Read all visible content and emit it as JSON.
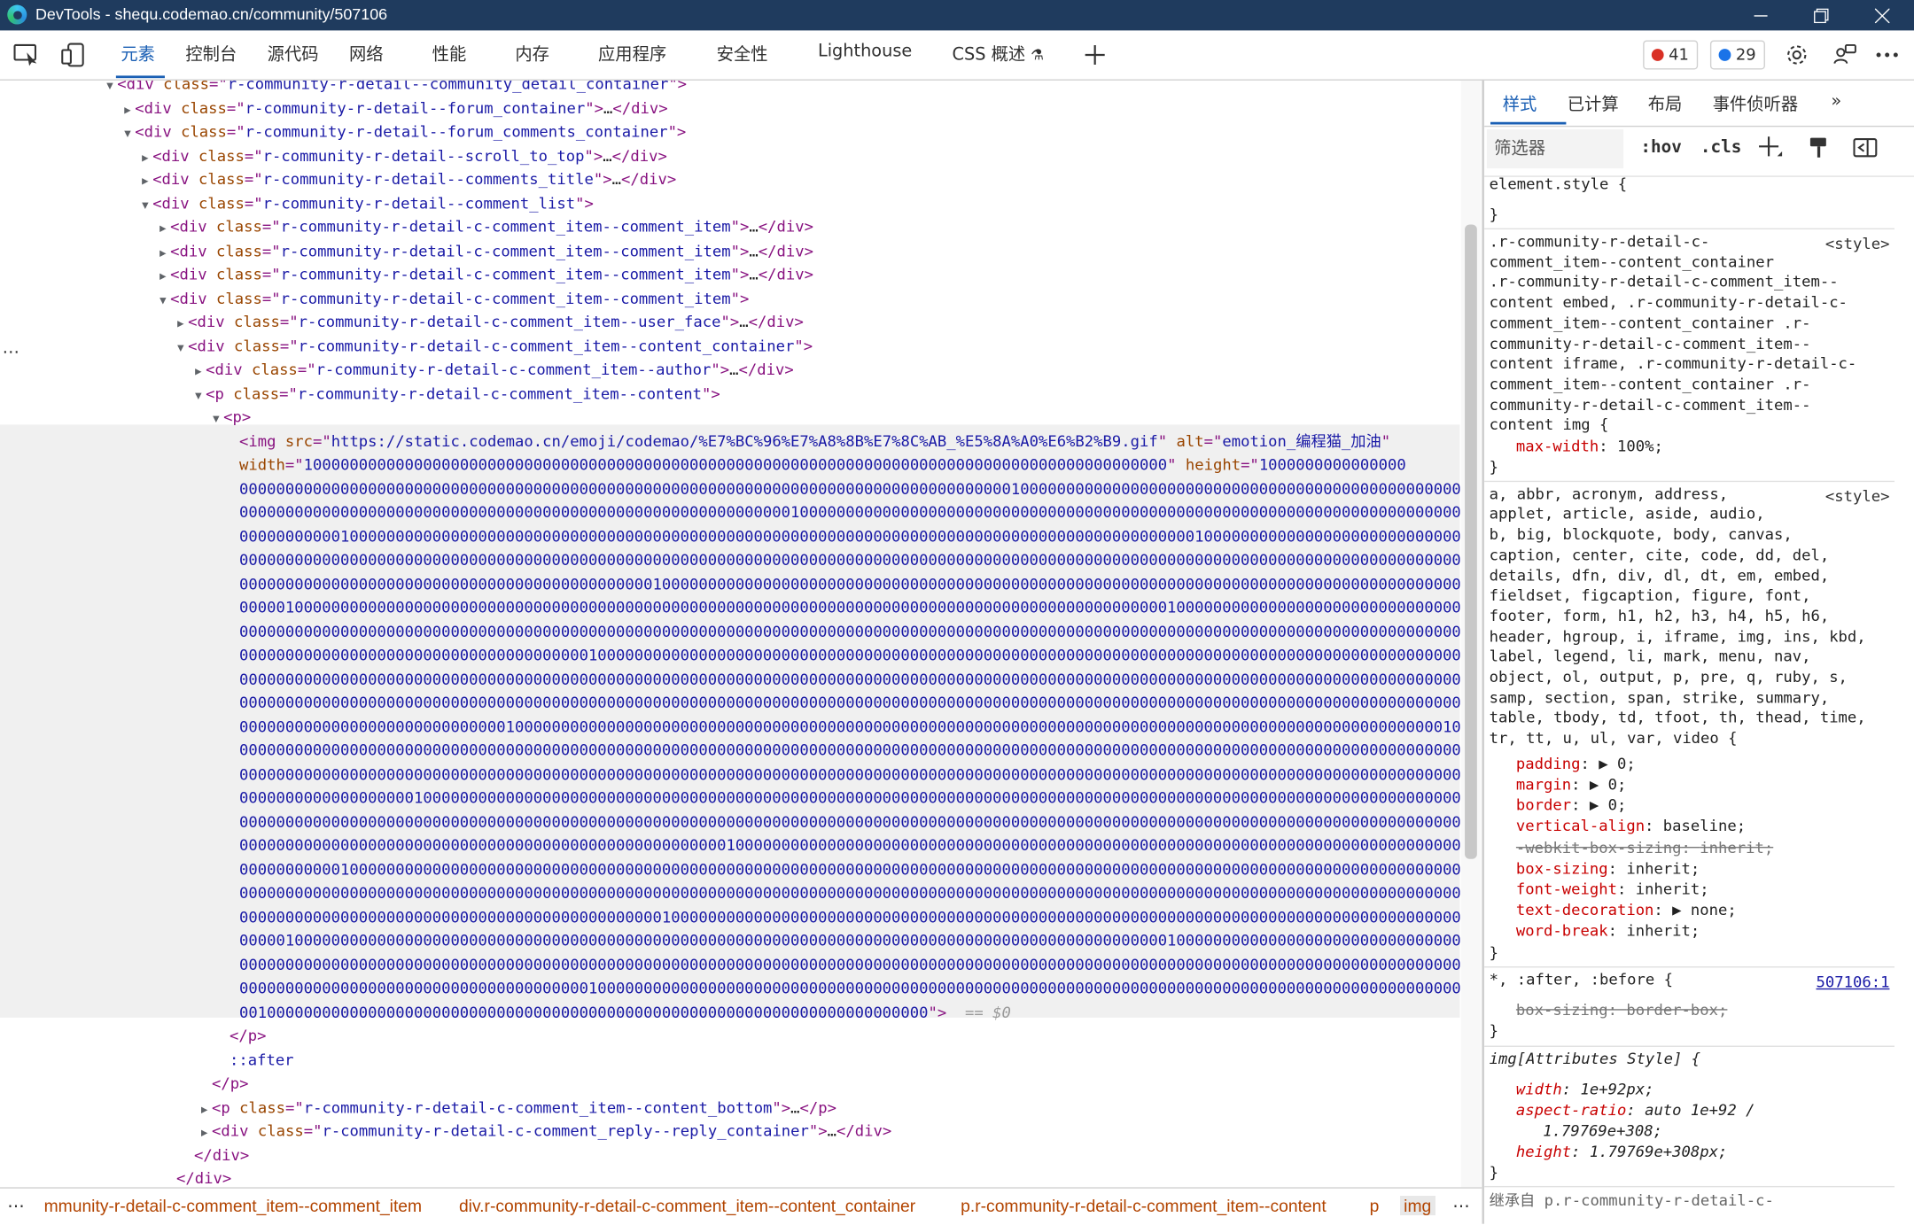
{
  "window": {
    "title": "DevTools - shequ.codemao.cn/community/507106"
  },
  "toolbar": {
    "tabs": [
      "元素",
      "控制台",
      "源代码",
      "网络",
      "性能",
      "内存",
      "应用程序",
      "安全性",
      "Lighthouse",
      "CSS 概述"
    ],
    "errors": "41",
    "issues": "29"
  },
  "dom": {
    "lines": [
      {
        "indent": 0,
        "arrow": "▼",
        "parts": [
          [
            "tg",
            "<div "
          ],
          [
            "an",
            "class"
          ],
          [
            "tg",
            "=\""
          ],
          [
            "av",
            "r-community-r-detail--community_detail_container"
          ],
          [
            "tg",
            "\">"
          ]
        ]
      },
      {
        "indent": 1,
        "arrow": "▶",
        "parts": [
          [
            "tg",
            "<div "
          ],
          [
            "an",
            "class"
          ],
          [
            "tg",
            "=\""
          ],
          [
            "av",
            "r-community-r-detail--forum_container"
          ],
          [
            "tg",
            "\">"
          ],
          [
            "tx",
            "…"
          ],
          [
            "tg",
            "</div>"
          ]
        ]
      },
      {
        "indent": 1,
        "arrow": "▼",
        "parts": [
          [
            "tg",
            "<div "
          ],
          [
            "an",
            "class"
          ],
          [
            "tg",
            "=\""
          ],
          [
            "av",
            "r-community-r-detail--forum_comments_container"
          ],
          [
            "tg",
            "\">"
          ]
        ]
      },
      {
        "indent": 2,
        "arrow": "▶",
        "parts": [
          [
            "tg",
            "<div "
          ],
          [
            "an",
            "class"
          ],
          [
            "tg",
            "=\""
          ],
          [
            "av",
            "r-community-r-detail--scroll_to_top"
          ],
          [
            "tg",
            "\">"
          ],
          [
            "tx",
            "…"
          ],
          [
            "tg",
            "</div>"
          ]
        ]
      },
      {
        "indent": 2,
        "arrow": "▶",
        "parts": [
          [
            "tg",
            "<div "
          ],
          [
            "an",
            "class"
          ],
          [
            "tg",
            "=\""
          ],
          [
            "av",
            "r-community-r-detail--comments_title"
          ],
          [
            "tg",
            "\">"
          ],
          [
            "tx",
            "…"
          ],
          [
            "tg",
            "</div>"
          ]
        ]
      },
      {
        "indent": 2,
        "arrow": "▼",
        "parts": [
          [
            "tg",
            "<div "
          ],
          [
            "an",
            "class"
          ],
          [
            "tg",
            "=\""
          ],
          [
            "av",
            "r-community-r-detail--comment_list"
          ],
          [
            "tg",
            "\">"
          ]
        ]
      },
      {
        "indent": 3,
        "arrow": "▶",
        "parts": [
          [
            "tg",
            "<div "
          ],
          [
            "an",
            "class"
          ],
          [
            "tg",
            "=\""
          ],
          [
            "av",
            "r-community-r-detail-c-comment_item--comment_item"
          ],
          [
            "tg",
            "\">"
          ],
          [
            "tx",
            "…"
          ],
          [
            "tg",
            "</div>"
          ]
        ]
      },
      {
        "indent": 3,
        "arrow": "▶",
        "parts": [
          [
            "tg",
            "<div "
          ],
          [
            "an",
            "class"
          ],
          [
            "tg",
            "=\""
          ],
          [
            "av",
            "r-community-r-detail-c-comment_item--comment_item"
          ],
          [
            "tg",
            "\">"
          ],
          [
            "tx",
            "…"
          ],
          [
            "tg",
            "</div>"
          ]
        ]
      },
      {
        "indent": 3,
        "arrow": "▶",
        "parts": [
          [
            "tg",
            "<div "
          ],
          [
            "an",
            "class"
          ],
          [
            "tg",
            "=\""
          ],
          [
            "av",
            "r-community-r-detail-c-comment_item--comment_item"
          ],
          [
            "tg",
            "\">"
          ],
          [
            "tx",
            "…"
          ],
          [
            "tg",
            "</div>"
          ]
        ]
      },
      {
        "indent": 3,
        "arrow": "▼",
        "parts": [
          [
            "tg",
            "<div "
          ],
          [
            "an",
            "class"
          ],
          [
            "tg",
            "=\""
          ],
          [
            "av",
            "r-community-r-detail-c-comment_item--comment_item"
          ],
          [
            "tg",
            "\">"
          ]
        ]
      },
      {
        "indent": 4,
        "arrow": "▶",
        "parts": [
          [
            "tg",
            "<div "
          ],
          [
            "an",
            "class"
          ],
          [
            "tg",
            "=\""
          ],
          [
            "av",
            "r-community-r-detail-c-comment_item--user_face"
          ],
          [
            "tg",
            "\">"
          ],
          [
            "tx",
            "…"
          ],
          [
            "tg",
            "</div>"
          ]
        ]
      },
      {
        "indent": 4,
        "arrow": "▼",
        "parts": [
          [
            "tg",
            "<div "
          ],
          [
            "an",
            "class"
          ],
          [
            "tg",
            "=\""
          ],
          [
            "av",
            "r-community-r-detail-c-comment_item--content_container"
          ],
          [
            "tg",
            "\">"
          ]
        ]
      },
      {
        "indent": 5,
        "arrow": "▶",
        "parts": [
          [
            "tg",
            "<div "
          ],
          [
            "an",
            "class"
          ],
          [
            "tg",
            "=\""
          ],
          [
            "av",
            "r-community-r-detail-c-comment_item--author"
          ],
          [
            "tg",
            "\">"
          ],
          [
            "tx",
            "…"
          ],
          [
            "tg",
            "</div>"
          ]
        ]
      },
      {
        "indent": 5,
        "arrow": "▼",
        "parts": [
          [
            "tg",
            "<p "
          ],
          [
            "an",
            "class"
          ],
          [
            "tg",
            "=\""
          ],
          [
            "av",
            "r-community-r-detail-c-comment_item--content"
          ],
          [
            "tg",
            "\">"
          ]
        ]
      },
      {
        "indent": 6,
        "arrow": "▼",
        "parts": [
          [
            "tg",
            "<p>"
          ]
        ]
      }
    ],
    "img_line1": [
      [
        "tg",
        "<img "
      ],
      [
        "an",
        "src"
      ],
      [
        "tg",
        "=\""
      ],
      [
        "av",
        "https://static.codemao.cn/emoji/codemao/%E7%BC%96%E7%A8%8B%E7%8C%AB_%E5%8A%A0%E6%B2%B9.gif"
      ],
      [
        "tg",
        "\" "
      ],
      [
        "an",
        "alt"
      ],
      [
        "tg",
        "=\""
      ],
      [
        "av",
        "emotion_编程猫_加油"
      ],
      [
        "tg",
        "\""
      ]
    ],
    "img_line2": [
      [
        "an",
        "width"
      ],
      [
        "tg",
        "=\""
      ],
      [
        "av",
        "1000000000000000000000000000000000000000000000000000000000000000000000000000000000000000000000"
      ],
      [
        "tg",
        "\" "
      ],
      [
        "an",
        "height"
      ],
      [
        "tg",
        "=\""
      ],
      [
        "av",
        "1000000000000000"
      ]
    ],
    "digit_rows": [
      "000000000000000000000000000000000000000000000000000000000000000000000000000000000000100000000000000000000000000000000000000000000000000",
      "000000000000000000000000000000000000000000000000000000000000100000000000000000000000000000000000000000000000000000000000000000000000000",
      "000000000001000000000000000000000000000000000000000000000000000000000000000000000000000000000000000000001000000000000000000000000000000",
      "000000000000000000000000000000000000000000000000000000000000000000000000000000000000000000000000000000000000000000000000000000000000000",
      "000000000000000000000000000000000000000000000100000000000000000000000000000000000000000000000000000000000000000000000000000000000000000",
      "000001000000000000000000000000000000000000000000000000000000000000000000000000000000000000000000000001000000000000000000000000000000000",
      "000000000000000000000000000000000000000000000000000000000000000000000000000000000000000000000000000000000000000000000000000000000000000",
      "000000000000000000000000000000000000001000000000000000000000000000000000000000000000000000000000000000000000000000000000000000000000001",
      "000000000000000000000000000000000000000000000000000000000000000000000000000000000000000000000000000000000000000000000000000000000000000",
      "000000000000000000000000000000000000000000000000000000000000000000000000000000000000000000000000000000000000000000000000000000000000000",
      "000000000000000000000000000001000000000000000000000000000000000000000000000000000000000000000000000000000000000000000000000000000001000",
      "000000000000000000000000000000000000000000000000000000000000000000000000000000000000000000000000000000000000000000000000000000000000000",
      "000000000000000000000000000000000000000000000000000000000000000000000000000000000000000000000000000000000000000000000000000000000000000",
      "000000000000000000010000000000000000000000000000000000000000000000000000000000000000000000000000000000000000000000000000000000000000000",
      "000000000000000000000000000000000000000000000000000000000000000000000000000000000000000000000000000000000000000000000000000000000000000",
      "000000000000000000000000000000000000000000000000000001000000000000000000000000000000000000000000000000000000000000000000000000000000000",
      "000000000001000000000000000000000000000000000000000000000000000000000000000000000000000000000000000000000000000000000000000000000000000",
      "000000000000000000000000000000000000000000000000000000000000000000000000000000000000000000000000000000000000000000000000000000000000000",
      "000000000000000000000000000000000000000000000010000000000000000000000000000000000000000000000000000000000000000000000000000000000000000",
      "000001000000000000000000000000000000000000000000000000000000000000000000000000000000000000000000000001000000000000000000000000000000000",
      "000000000000000000000000000000000000000000000000000000000000000000000000000000000000000000000000000000000000000000000000000000000000000",
      "000000000000000000000000000000000000001000000000000000000000000000000000000000000000000000000000000000000000000000000000000000000000000"
    ],
    "digit_last": "001000000000000000000000000000000000000000000000000000000000000000000000000",
    "eq": "== $0",
    "after_lines": [
      {
        "indent": 6,
        "parts": [
          [
            "tg",
            "</p>"
          ]
        ]
      },
      {
        "indent": 6,
        "parts": [
          [
            "pe",
            "::after"
          ]
        ]
      },
      {
        "indent": 5,
        "parts": [
          [
            "tg",
            "</p>"
          ]
        ]
      },
      {
        "indent": 5,
        "arrow": "▶",
        "parts": [
          [
            "tg",
            "<p "
          ],
          [
            "an",
            "class"
          ],
          [
            "tg",
            "=\""
          ],
          [
            "av",
            "r-community-r-detail-c-comment_item--content_bottom"
          ],
          [
            "tg",
            "\">"
          ],
          [
            "tx",
            "…"
          ],
          [
            "tg",
            "</p>"
          ]
        ]
      },
      {
        "indent": 5,
        "arrow": "▶",
        "parts": [
          [
            "tg",
            "<div "
          ],
          [
            "an",
            "class"
          ],
          [
            "tg",
            "=\""
          ],
          [
            "av",
            "r-community-r-detail-c-comment_reply--reply_container"
          ],
          [
            "tg",
            "\">"
          ],
          [
            "tx",
            "…"
          ],
          [
            "tg",
            "</div>"
          ]
        ]
      },
      {
        "indent": 4,
        "parts": [
          [
            "tg",
            "</div>"
          ]
        ]
      },
      {
        "indent": 3,
        "parts": [
          [
            "tg",
            "</div>"
          ]
        ]
      }
    ]
  },
  "breadcrumb": {
    "items": [
      "mmunity-r-detail-c-comment_item--comment_item",
      "div.r-community-r-detail-c-comment_item--content_container",
      "p.r-community-r-detail-c-comment_item--content",
      "p",
      "img"
    ]
  },
  "styles": {
    "tabs": [
      "样式",
      "已计算",
      "布局",
      "事件侦听器"
    ],
    "filter_placeholder": "筛选器",
    "hov": ":hov",
    "cls": ".cls",
    "element_style": "element.style {",
    "close_brace": "}",
    "rule1_origin": "<style>",
    "rule1_selector": [
      ".r-community-r-detail-c-",
      "comment_item--content_container",
      ".r-community-r-detail-c-comment_item--",
      "content embed, .r-community-r-detail-c-",
      "comment_item--content_container .r-",
      "community-r-detail-c-comment_item--",
      "content iframe, .r-community-r-detail-c-",
      "comment_item--content_container .r-",
      "community-r-detail-c-comment_item--",
      "content img {"
    ],
    "rule1_prop": "max-width",
    "rule1_val": "100%;",
    "rule2_origin": "<style>",
    "rule2_selector": [
      "a, abbr, acronym, address,",
      "applet, article, aside, audio,",
      "b, big, blockquote, body, canvas,",
      "caption, center, cite, code, dd, del,",
      "details, dfn, div, dl, dt, em, embed,",
      "fieldset, figcaption, figure, font,",
      "footer, form, h1, h2, h3, h4, h5, h6,",
      "header, hgroup, i, iframe, img, ins, kbd,",
      "label, legend, li, mark, menu, nav,",
      "object, ol, output, p, pre, q, ruby, s,",
      "samp, section, span, strike, summary,",
      "table, tbody, td, tfoot, th, thead, time,",
      "tr, tt, u, ul, var, video {"
    ],
    "rule2_props": [
      [
        "padding",
        "▶ 0;",
        ""
      ],
      [
        "margin",
        "▶ 0;",
        ""
      ],
      [
        "border",
        "▶ 0;",
        ""
      ],
      [
        "vertical-align",
        "baseline;",
        ""
      ],
      [
        "-webkit-box-sizing",
        "inherit;",
        "strike"
      ],
      [
        "box-sizing",
        "inherit;",
        ""
      ],
      [
        "font-weight",
        "inherit;",
        ""
      ],
      [
        "text-decoration",
        "▶ none;",
        ""
      ],
      [
        "word-break",
        "inherit;",
        ""
      ]
    ],
    "rule3_selector": "*, :after, :before {",
    "rule3_origin": "507106:1",
    "rule3_prop": "box-sizing",
    "rule3_val": "border-box;",
    "rule4_selector": "img[Attributes Style] {",
    "rule4_lines": [
      [
        "width",
        "1e+92px;"
      ],
      [
        "aspect-ratio",
        "auto 1e+92 /"
      ],
      [
        "",
        "1.79769e+308;"
      ],
      [
        "height",
        "1.79769e+308px;"
      ]
    ],
    "inherited_label": "继承自 p.r-community-r-detail-c-"
  }
}
